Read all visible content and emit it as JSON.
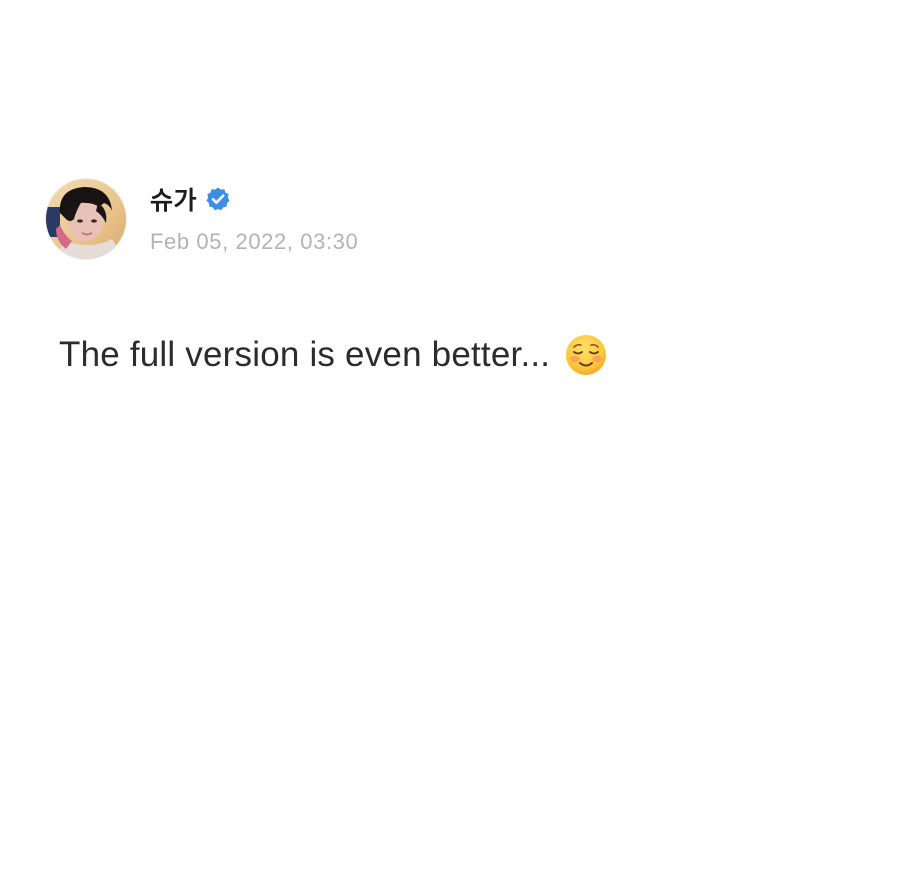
{
  "post": {
    "author": {
      "name": "슈가",
      "verified": true,
      "avatar": "profile-photo"
    },
    "timestamp": "Feb 05, 2022, 03:30",
    "text": "The full version is even better...",
    "emoji": "smiling-face-icon"
  },
  "colors": {
    "verified_badge": "#3a8ee6",
    "name_text": "#1c1c1e",
    "timestamp_text": "#b3b3b8",
    "body_text": "#2b2b30",
    "background": "#ffffff"
  }
}
